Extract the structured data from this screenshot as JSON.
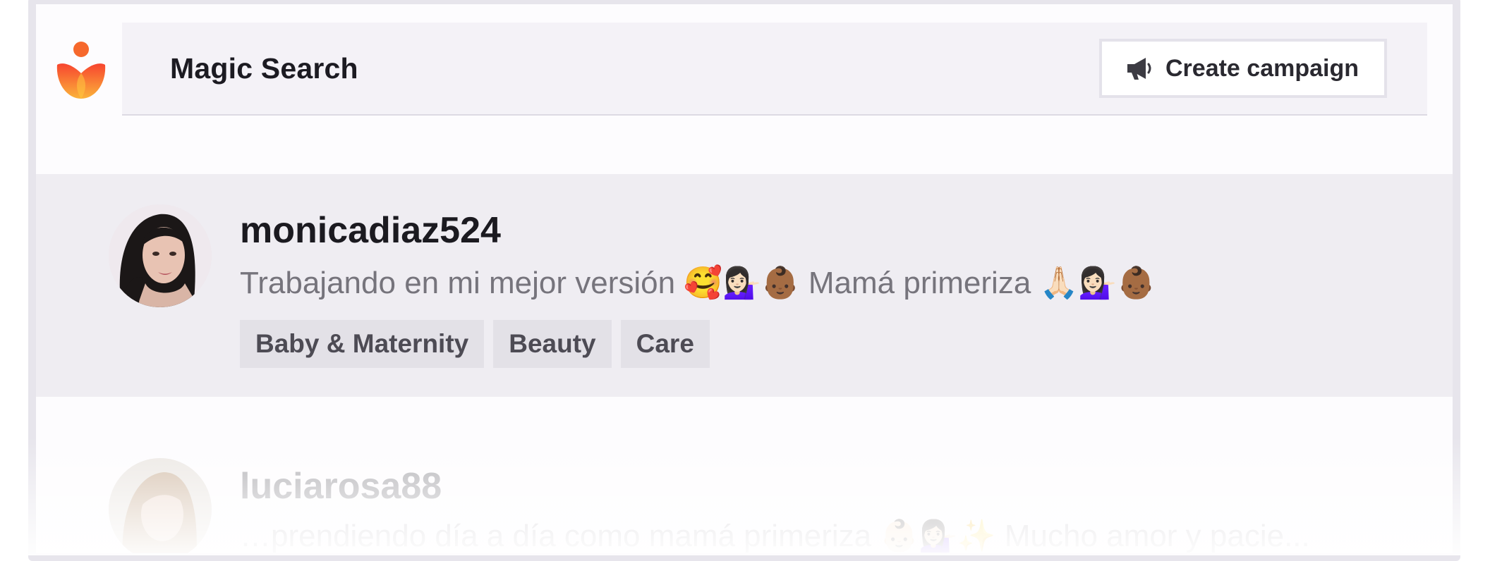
{
  "header": {
    "title": "Magic Search",
    "create_campaign_label": "Create campaign",
    "create_campaign_icon": "megaphone-icon",
    "logo_icon": "lotus-logo-icon",
    "accent_color": "#f6682c"
  },
  "results": [
    {
      "username": "monicadiaz524",
      "bio": "Trabajando en mi mejor versión 🥰💁🏻‍♀️👶🏾 Mamá primeriza 🙏🏻💁🏻‍♀️👶🏾",
      "tags": [
        "Baby & Maternity",
        "Beauty",
        "Care"
      ]
    },
    {
      "username": "luciarosa88",
      "bio": "…prendiendo día a día como mamá primeriza 👶🏻💁🏻‍♀️✨ Mucho amor y pacie..."
    }
  ]
}
